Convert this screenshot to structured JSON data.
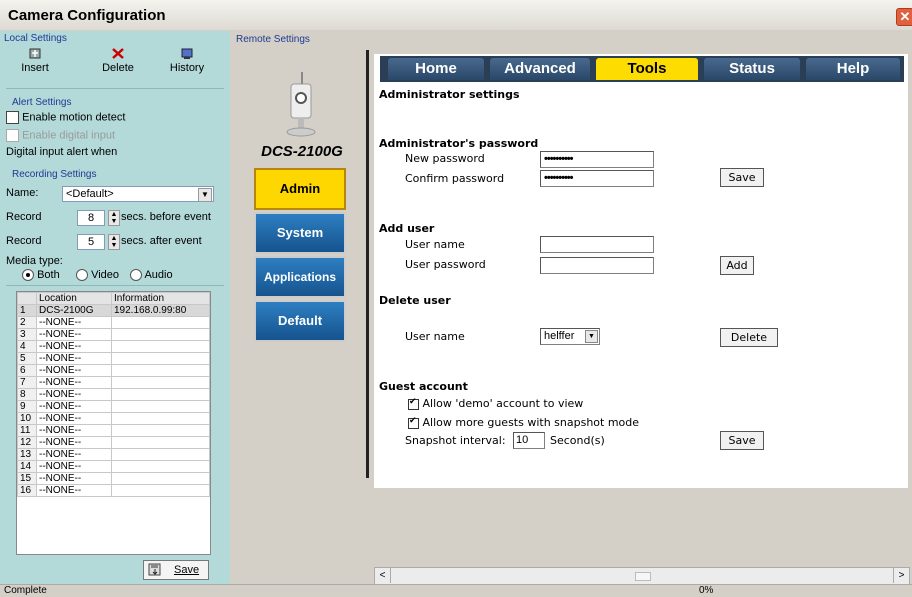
{
  "window": {
    "title": "Camera Configuration"
  },
  "local_settings": {
    "group_label": "Local Settings",
    "toolbar": {
      "insert": "Insert",
      "delete": "Delete",
      "history": "History"
    },
    "alert": {
      "group_label": "Alert Settings",
      "enable_motion": "Enable motion detect",
      "enable_digital": "Enable digital input",
      "digital_alert_when": "Digital input alert when"
    },
    "recording": {
      "group_label": "Recording Settings",
      "name_label": "Name:",
      "name_value": "<Default>",
      "record_label": "Record",
      "before_value": "8",
      "before_suffix": "secs. before event",
      "after_value": "5",
      "after_suffix": "secs. after event",
      "media_type_label": "Media type:",
      "media_options": [
        "Both",
        "Video",
        "Audio"
      ],
      "media_selected": "Both"
    },
    "grid": {
      "columns": [
        "Location",
        "Information"
      ],
      "rows": [
        {
          "n": "1",
          "location": "DCS-2100G",
          "info": "192.168.0.99:80"
        },
        {
          "n": "2",
          "location": "--NONE--",
          "info": ""
        },
        {
          "n": "3",
          "location": "--NONE--",
          "info": ""
        },
        {
          "n": "4",
          "location": "--NONE--",
          "info": ""
        },
        {
          "n": "5",
          "location": "--NONE--",
          "info": ""
        },
        {
          "n": "6",
          "location": "--NONE--",
          "info": ""
        },
        {
          "n": "7",
          "location": "--NONE--",
          "info": ""
        },
        {
          "n": "8",
          "location": "--NONE--",
          "info": ""
        },
        {
          "n": "9",
          "location": "--NONE--",
          "info": ""
        },
        {
          "n": "10",
          "location": "--NONE--",
          "info": ""
        },
        {
          "n": "11",
          "location": "--NONE--",
          "info": ""
        },
        {
          "n": "12",
          "location": "--NONE--",
          "info": ""
        },
        {
          "n": "13",
          "location": "--NONE--",
          "info": ""
        },
        {
          "n": "14",
          "location": "--NONE--",
          "info": ""
        },
        {
          "n": "15",
          "location": "--NONE--",
          "info": ""
        },
        {
          "n": "16",
          "location": "--NONE--",
          "info": ""
        }
      ]
    },
    "save_label": "Save"
  },
  "remote_settings": {
    "group_label": "Remote Settings",
    "camera_model": "DCS-2100G",
    "nav": [
      "Admin",
      "System",
      "Applications",
      "Default"
    ],
    "nav_active": "Admin",
    "tabs": [
      "Home",
      "Advanced",
      "Tools",
      "Status",
      "Help"
    ],
    "tab_active": "Tools",
    "page": {
      "title": "Administrator settings",
      "admin_pw": {
        "heading": "Administrator's password",
        "new_label": "New password",
        "new_value": "••••••••••",
        "confirm_label": "Confirm password",
        "confirm_value": "••••••••••",
        "save": "Save"
      },
      "add_user": {
        "heading": "Add user",
        "name_label": "User name",
        "name_value": "",
        "pw_label": "User password",
        "pw_value": "",
        "add": "Add"
      },
      "delete_user": {
        "heading": "Delete user",
        "name_label": "User name",
        "selected": "helffer",
        "delete": "Delete"
      },
      "guest": {
        "heading": "Guest account",
        "allow_demo": "Allow 'demo' account to view",
        "allow_demo_checked": true,
        "allow_more": "Allow more guests with snapshot mode",
        "allow_more_checked": true,
        "interval_label": "Snapshot interval:",
        "interval_value": "10",
        "interval_unit": "Second(s)",
        "save": "Save"
      }
    }
  },
  "statusbar": {
    "status": "Complete",
    "progress_text": "0%"
  }
}
